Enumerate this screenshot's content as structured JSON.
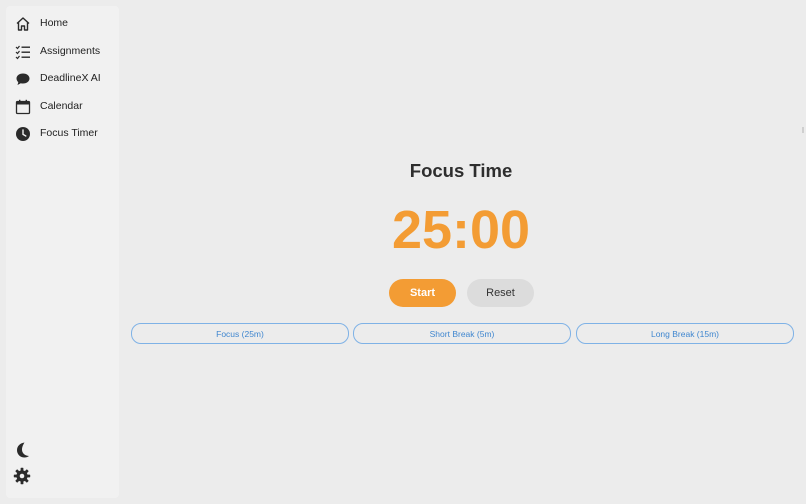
{
  "sidebar": {
    "items": [
      {
        "label": "Home",
        "icon": "home-icon"
      },
      {
        "label": "Assignments",
        "icon": "checklist-icon"
      },
      {
        "label": "DeadlineX AI",
        "icon": "chat-bubble-icon"
      },
      {
        "label": "Calendar",
        "icon": "calendar-icon"
      },
      {
        "label": "Focus Timer",
        "icon": "clock-icon"
      }
    ],
    "bottom": [
      {
        "icon": "moon-icon"
      },
      {
        "icon": "gear-icon"
      }
    ]
  },
  "main": {
    "title": "Focus Time",
    "timer": "25:00",
    "start_label": "Start",
    "reset_label": "Reset",
    "modes": [
      {
        "label": "Focus (25m)"
      },
      {
        "label": "Short Break (5m)"
      },
      {
        "label": "Long Break (15m)"
      }
    ]
  },
  "colors": {
    "accent": "#f39c34",
    "mode_border": "#7fb2e6",
    "mode_text": "#3f86cf",
    "background": "#ececec"
  }
}
